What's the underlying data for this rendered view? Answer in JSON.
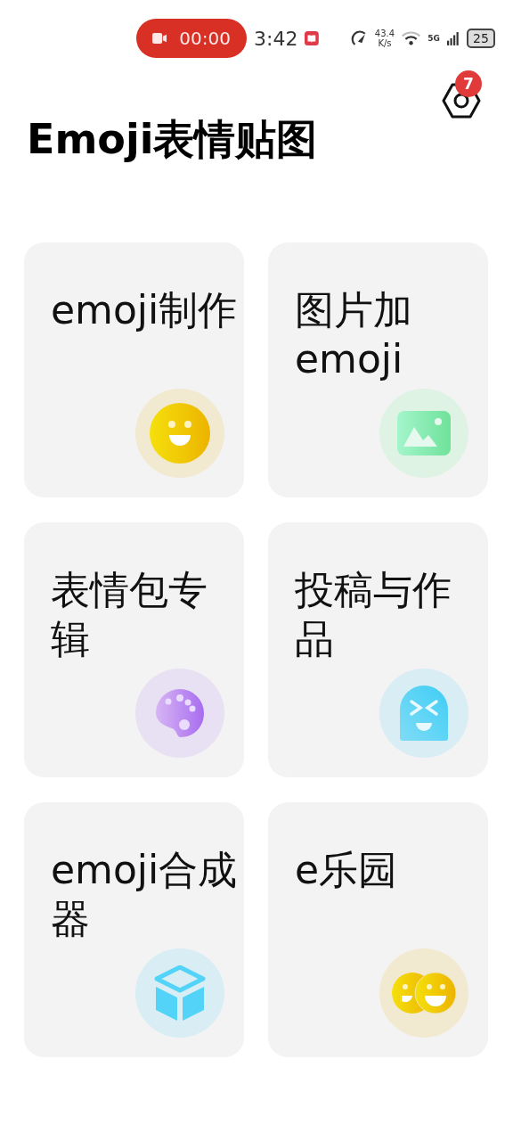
{
  "status_bar": {
    "recording": "00:00",
    "time": "3:42",
    "speed_value": "43.4",
    "speed_unit": "K/s",
    "network": "5G",
    "battery": "25"
  },
  "header": {
    "title": "Emoji表情贴图",
    "settings_badge": "7"
  },
  "cards": [
    {
      "label": "emoji制作",
      "kind": "smiley"
    },
    {
      "label": "图片加emoji",
      "kind": "image"
    },
    {
      "label": "表情包专辑",
      "kind": "palette"
    },
    {
      "label": "投稿与作品",
      "kind": "ghost"
    },
    {
      "label": "emoji合成器",
      "kind": "cube"
    },
    {
      "label": "e乐园",
      "kind": "duo"
    }
  ]
}
